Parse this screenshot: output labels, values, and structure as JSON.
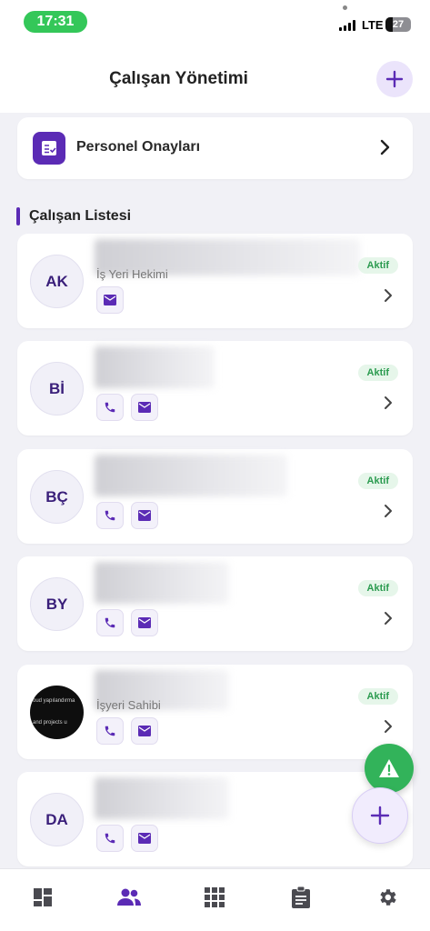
{
  "status_bar": {
    "time": "17:31",
    "network": "LTE",
    "battery": "27",
    "battery_level": 0.27
  },
  "header": {
    "title": "Çalışan Yönetimi",
    "add_icon": "plus-icon"
  },
  "approvals": {
    "label": "Personel Onayları",
    "icon": "approval-list-icon"
  },
  "section": {
    "title": "Çalışan Listesi"
  },
  "employees": [
    {
      "initials": "AK",
      "role": "İş Yeri Hekimi",
      "status": "Aktif"
    },
    {
      "initials": "Bİ",
      "role": "",
      "status": "Aktif"
    },
    {
      "initials": "BÇ",
      "role": "",
      "status": "Aktif"
    },
    {
      "initials": "BY",
      "role": "",
      "status": "Aktif"
    },
    {
      "initials": "",
      "role": "İşyeri Sahibi",
      "status": "Aktif",
      "photo_lines": [
        "oud yapılandırma",
        "and projects u"
      ]
    },
    {
      "initials": "DA",
      "role": "",
      "status": ""
    }
  ],
  "colors": {
    "accent": "#5b2bb5",
    "active_badge_bg": "#e6f6ea",
    "active_badge_text": "#2c9b50",
    "warning_fab": "#32b35a"
  },
  "nav": [
    "dashboard-icon",
    "people-icon",
    "apps-grid-icon",
    "clipboard-icon",
    "settings-gear-icon"
  ]
}
